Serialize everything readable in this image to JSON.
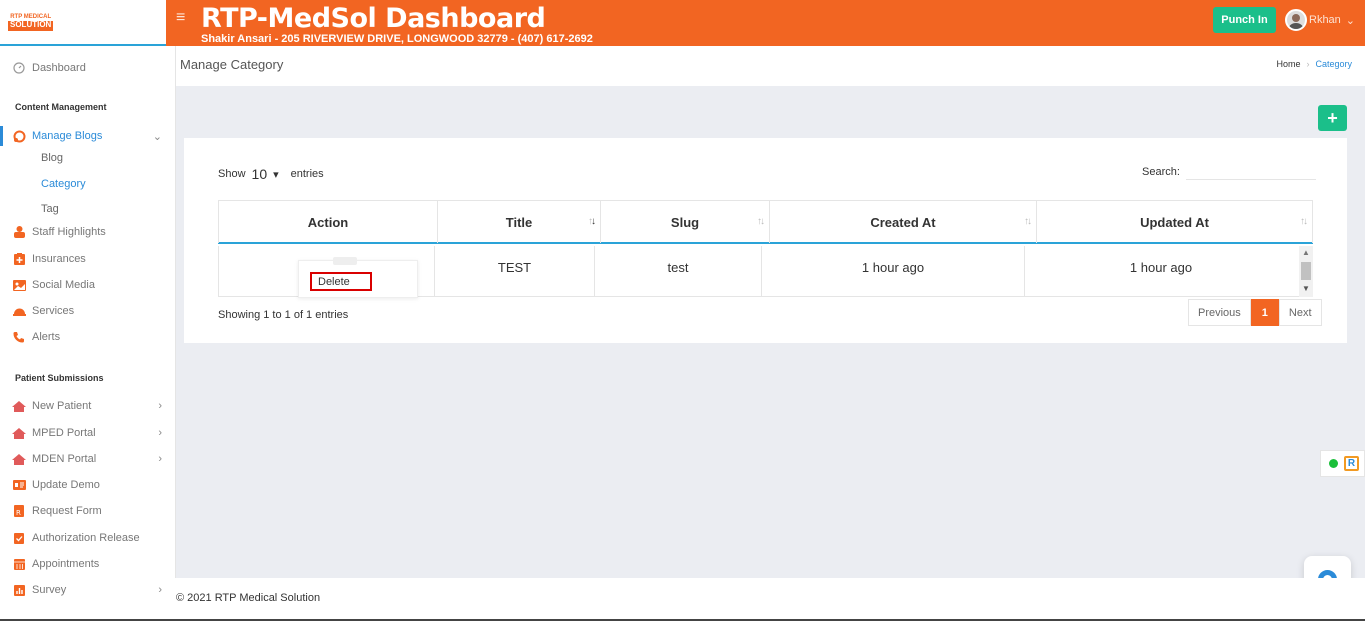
{
  "app": {
    "logo_top": "RTP MEDICAL",
    "logo_bottom": "SOLUTION",
    "title": "RTP-MedSol Dashboard",
    "subtitle": "Shakir Ansari - 205 RIVERVIEW DRIVE, LONGWOOD 32779 - (407) 617-2692",
    "punch_label": "Punch In",
    "user_name": "Rkhan",
    "accent": "#f26522",
    "green": "#1bbf8a",
    "blue": "#2b8bd8"
  },
  "sidebar": {
    "dashboard": "Dashboard",
    "section_content": "Content Management",
    "manage_blogs": "Manage Blogs",
    "sub_blog": "Blog",
    "sub_category": "Category",
    "sub_tag": "Tag",
    "staff": "Staff Highlights",
    "insurances": "Insurances",
    "social": "Social Media",
    "services": "Services",
    "alerts": "Alerts",
    "section_patient": "Patient Submissions",
    "new_patient": "New Patient",
    "mped": "MPED Portal",
    "mden": "MDEN Portal",
    "update_demo": "Update Demo",
    "request_form": "Request Form",
    "auth_release": "Authorization Release",
    "appointments": "Appointments",
    "survey": "Survey"
  },
  "page": {
    "title": "Manage Category",
    "breadcrumb_home": "Home",
    "breadcrumb_current": "Category",
    "add_label": "+"
  },
  "table": {
    "show_label": "Show",
    "entries_value": "10",
    "entries_label": "entries",
    "search_label": "Search:",
    "headers": [
      "Action",
      "Title",
      "Slug",
      "Created At",
      "Updated At"
    ],
    "row": {
      "title": "TEST",
      "slug": "test",
      "created": "1 hour ago",
      "updated": "1 hour ago"
    },
    "action_menu_item": "Delete",
    "info": "Showing 1 to 1 of 1 entries",
    "prev": "Previous",
    "page": "1",
    "next": "Next"
  },
  "footer": {
    "copyright": "© 2021 RTP Medical Solution"
  }
}
